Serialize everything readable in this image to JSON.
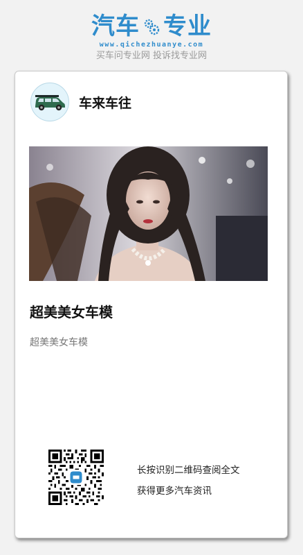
{
  "brand": {
    "logo_left": "汽车",
    "logo_right": "专业",
    "url": "www.qichezhuanye.com",
    "slogan": "买车问专业网 投诉找专业网",
    "accent_color": "#2f8ccc"
  },
  "card": {
    "author": {
      "avatar_icon": "car-icon",
      "name": "车来车往"
    },
    "cover": {
      "icon": "cover-photo"
    },
    "title": "超美美女车模",
    "summary": "超美美女车模",
    "qr": {
      "icon": "qr-code-icon",
      "line1": "长按识别二维码查阅全文",
      "line2": "获得更多汽车资讯"
    }
  }
}
